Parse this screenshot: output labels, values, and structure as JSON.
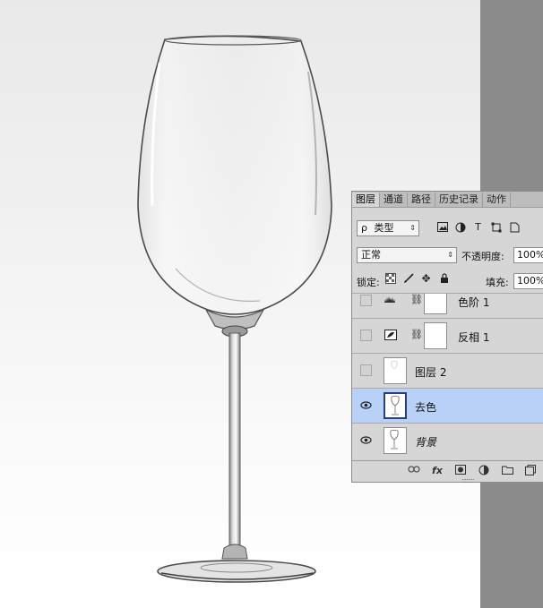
{
  "panel": {
    "tabs": [
      {
        "label": "图层",
        "active": true
      },
      {
        "label": "通道",
        "active": false
      },
      {
        "label": "路径",
        "active": false
      },
      {
        "label": "历史记录",
        "active": false
      },
      {
        "label": "动作",
        "active": false
      }
    ],
    "filter": {
      "search_symbol": "ρ",
      "value": "类型"
    },
    "blend_mode": "正常",
    "opacity_label": "不透明度:",
    "opacity_value": "100%",
    "lock_label": "锁定:",
    "fill_label": "填充:",
    "fill_value": "100%",
    "layers": [
      {
        "name": "色阶 1",
        "type": "adjustment-levels",
        "visible": false,
        "selected": false
      },
      {
        "name": "反相 1",
        "type": "adjustment-invert",
        "visible": false,
        "selected": false
      },
      {
        "name": "图层 2",
        "type": "pixel",
        "visible": false,
        "selected": false
      },
      {
        "name": "去色",
        "type": "pixel",
        "visible": true,
        "selected": true
      },
      {
        "name": "背景",
        "type": "background",
        "visible": true,
        "selected": false
      }
    ],
    "bottom_icons": [
      "link-icon",
      "fx-icon",
      "mask-icon",
      "adjustment-icon",
      "folder-icon",
      "new-layer-icon"
    ],
    "fx_label": "fx"
  },
  "colors": {
    "selected_layer": "#b9d0f7",
    "panel_bg": "#d6d6d6",
    "gutter": "#8b8b8b"
  }
}
